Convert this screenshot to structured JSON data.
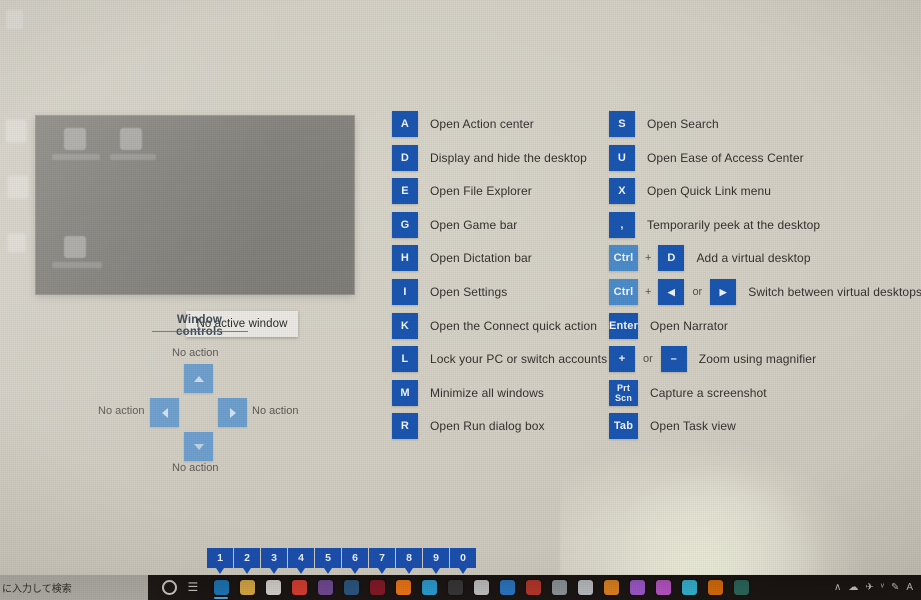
{
  "screen": {
    "kind": "windows-10-win-key-shortcut-overlay",
    "accent_blue": "#1a56b0",
    "accent_blue_light": "#4c8ccb",
    "number_blue": "#1b4fae",
    "wc_arrow_blue": "#6f9fce"
  },
  "preview": {
    "no_active_window_label": "No active window"
  },
  "window_controls": {
    "title": "Window controls",
    "up_label": "No action",
    "down_label": "No action",
    "left_label": "No action",
    "right_label": "No action",
    "up_icon": "chevron-up-icon",
    "down_icon": "chevron-down-icon",
    "left_icon": "chevron-left-icon",
    "right_icon": "chevron-right-icon"
  },
  "shortcuts_left": [
    {
      "keys": [
        {
          "label": "A",
          "style": "dark"
        }
      ],
      "desc": "Open Action center"
    },
    {
      "keys": [
        {
          "label": "D",
          "style": "dark"
        }
      ],
      "desc": "Display and hide the desktop"
    },
    {
      "keys": [
        {
          "label": "E",
          "style": "dark"
        }
      ],
      "desc": "Open File Explorer"
    },
    {
      "keys": [
        {
          "label": "G",
          "style": "dark"
        }
      ],
      "desc": "Open Game bar"
    },
    {
      "keys": [
        {
          "label": "H",
          "style": "dark"
        }
      ],
      "desc": "Open Dictation bar"
    },
    {
      "keys": [
        {
          "label": "I",
          "style": "dark"
        }
      ],
      "desc": "Open Settings"
    },
    {
      "keys": [
        {
          "label": "K",
          "style": "dark"
        }
      ],
      "desc": "Open the Connect quick action"
    },
    {
      "keys": [
        {
          "label": "L",
          "style": "dark"
        }
      ],
      "desc": "Lock your PC or switch accounts"
    },
    {
      "keys": [
        {
          "label": "M",
          "style": "dark"
        }
      ],
      "desc": "Minimize all windows"
    },
    {
      "keys": [
        {
          "label": "R",
          "style": "dark"
        }
      ],
      "desc": "Open Run dialog box"
    }
  ],
  "shortcuts_right": [
    {
      "keys": [
        {
          "label": "S",
          "style": "dark"
        }
      ],
      "desc": "Open Search"
    },
    {
      "keys": [
        {
          "label": "U",
          "style": "dark"
        }
      ],
      "desc": "Open Ease of Access Center"
    },
    {
      "keys": [
        {
          "label": "X",
          "style": "dark"
        }
      ],
      "desc": "Open Quick Link menu"
    },
    {
      "keys": [
        {
          "label": ",",
          "style": "dark"
        }
      ],
      "desc": "Temporarily peek at the desktop"
    },
    {
      "keys": [
        {
          "label": "Ctrl",
          "style": "light"
        },
        {
          "sep": "+"
        },
        {
          "label": "D",
          "style": "dark"
        }
      ],
      "desc": "Add a virtual desktop"
    },
    {
      "keys": [
        {
          "label": "Ctrl",
          "style": "light"
        },
        {
          "sep": "+"
        },
        {
          "label": "◀",
          "style": "dark"
        },
        {
          "sep": "or"
        },
        {
          "label": "▶",
          "style": "dark"
        }
      ],
      "desc": "Switch between virtual desktops"
    },
    {
      "keys": [
        {
          "label": "Enter",
          "style": "dark"
        }
      ],
      "desc": "Open Narrator"
    },
    {
      "keys": [
        {
          "label": "+",
          "style": "dark"
        },
        {
          "sep": "or"
        },
        {
          "label": "–",
          "style": "dark"
        }
      ],
      "desc": "Zoom using magnifier"
    },
    {
      "keys": [
        {
          "label": "Prt\nScn",
          "style": "dark"
        }
      ],
      "desc": "Capture a screenshot"
    },
    {
      "keys": [
        {
          "label": "Tab",
          "style": "dark"
        }
      ],
      "desc": "Open Task view"
    }
  ],
  "number_row": [
    "1",
    "2",
    "3",
    "4",
    "5",
    "6",
    "7",
    "8",
    "9",
    "0"
  ],
  "taskbar": {
    "search_placeholder": "に入力して検索",
    "icons": [
      {
        "name": "cortana-icon",
        "color": "transparent",
        "ring": true
      },
      {
        "name": "task-view-icon",
        "color": "transparent",
        "glyph": "☰"
      },
      {
        "name": "microsoft-edge-icon",
        "color": "#1f7fc4",
        "active": true
      },
      {
        "name": "file-explorer-icon",
        "color": "#e8b54b"
      },
      {
        "name": "microsoft-store-icon",
        "color": "#e6e3de"
      },
      {
        "name": "google-chrome-icon",
        "color": "#e84336"
      },
      {
        "name": "onenote-icon",
        "color": "#7a4f9e"
      },
      {
        "name": "todo-check-icon",
        "color": "#2f5d8a"
      },
      {
        "name": "app-red-square-icon",
        "color": "#8e1b2a"
      },
      {
        "name": "adobe-illustrator-icon",
        "color": "#ff7f18"
      },
      {
        "name": "adobe-photoshop-icon",
        "color": "#2fa8e0"
      },
      {
        "name": "davinci-resolve-icon",
        "color": "#3b3b3b"
      },
      {
        "name": "epic-games-icon",
        "color": "#cfcfcf"
      },
      {
        "name": "mail-icon",
        "color": "#2e7fd0"
      },
      {
        "name": "app-red-dot-icon",
        "color": "#c33b2f"
      },
      {
        "name": "app-grey-icon",
        "color": "#9aa0a6"
      },
      {
        "name": "calculator-icon",
        "color": "#c9ccd1"
      },
      {
        "name": "app-orange-triangle-icon",
        "color": "#ef8c22"
      },
      {
        "name": "app-violet-icon",
        "color": "#a95fd8"
      },
      {
        "name": "app-magenta-icon",
        "color": "#c45ad2"
      },
      {
        "name": "app-cyan-icon",
        "color": "#3ac0e0"
      },
      {
        "name": "firefox-icon",
        "color": "#e8740c"
      },
      {
        "name": "app-teal-circle-icon",
        "color": "#2e6f62"
      }
    ],
    "tray": [
      {
        "name": "show-hidden-icons-chevron",
        "glyph": "∧"
      },
      {
        "name": "cloud-storage-icon",
        "glyph": "☁"
      },
      {
        "name": "network-icon",
        "glyph": "✈"
      },
      {
        "name": "volume-icon",
        "glyph": "ᵛ"
      },
      {
        "name": "ime-pen-icon",
        "glyph": "✎"
      },
      {
        "name": "ime-mode-letter",
        "glyph": "A"
      }
    ]
  }
}
